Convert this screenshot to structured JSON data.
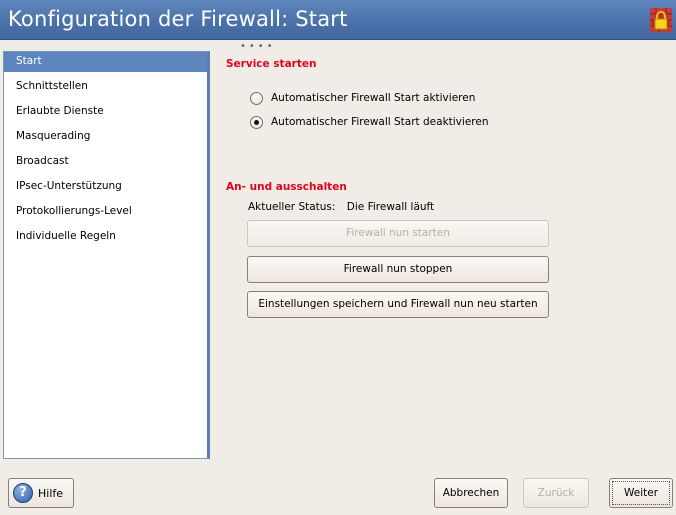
{
  "window": {
    "title": "Konfiguration der Firewall: Start",
    "lock_icon": "lock-icon",
    "title_color": "#4a72aa"
  },
  "sidebar": {
    "items": [
      {
        "label": "Start",
        "selected": true
      },
      {
        "label": "Schnittstellen"
      },
      {
        "label": "Erlaubte Dienste"
      },
      {
        "label": "Masquerading"
      },
      {
        "label": "Broadcast"
      },
      {
        "label": "IPsec-Unterstützung"
      },
      {
        "label": "Protokollierungs-Level"
      },
      {
        "label": "Individuelle Regeln"
      }
    ],
    "selected_color": "#5d86c1"
  },
  "service": {
    "title": "Service starten",
    "options": [
      {
        "label": "Automatischer Firewall Start aktivieren",
        "checked": false
      },
      {
        "label": "Automatischer Firewall Start deaktivieren",
        "checked": true
      }
    ]
  },
  "switch": {
    "title": "An- und ausschalten",
    "status_label": "Aktueller Status:",
    "status_value": "Die Firewall läuft",
    "start_button": "Firewall nun starten",
    "stop_button": "Firewall nun stoppen",
    "save_restart_button": "Einstellungen speichern und Firewall nun neu starten"
  },
  "footer": {
    "help": "Hilfe",
    "cancel": "Abbrechen",
    "back": "Zurück",
    "next": "Weiter"
  },
  "colors": {
    "section_title": "#e8001c",
    "background": "#f0ece6"
  }
}
